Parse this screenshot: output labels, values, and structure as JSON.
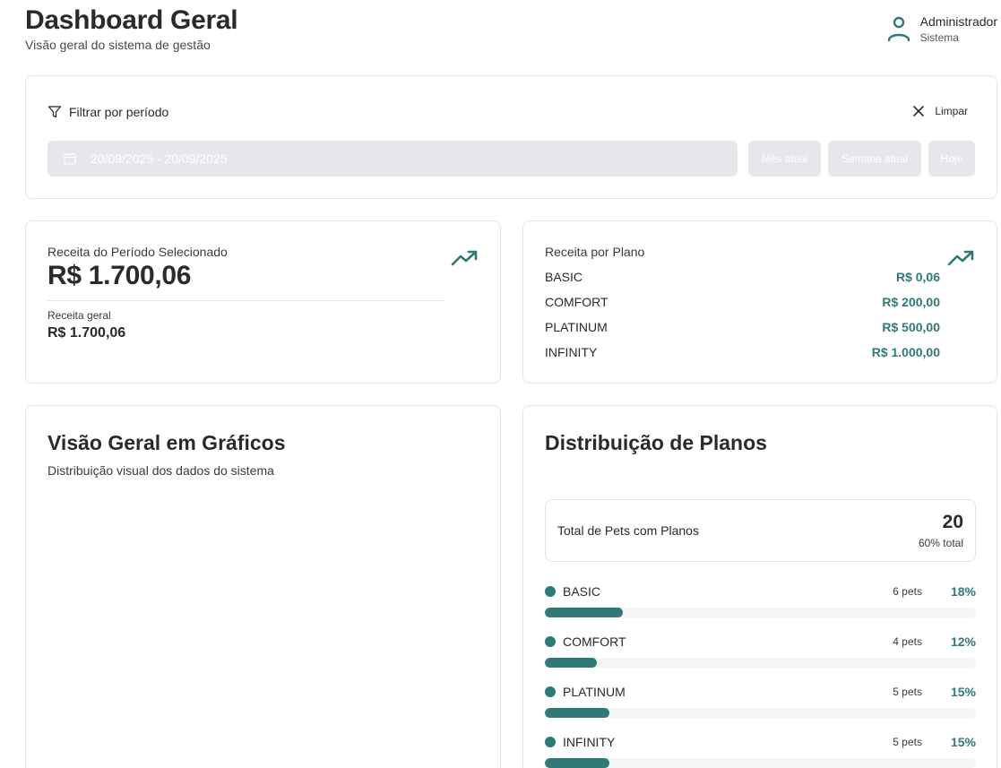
{
  "header": {
    "title": "Dashboard Geral",
    "subtitle": "Visão geral do sistema de gestão",
    "user": {
      "name": "Administrador",
      "role": "Sistema",
      "icon": "user-icon"
    }
  },
  "filter": {
    "title": "Filtrar por período",
    "icon": "filter-icon",
    "clear_label": "Limpar",
    "date_range": "20/09/2025 - 20/09/2025",
    "quick_buttons": {
      "month": "Mês atual",
      "week": "Semana atual",
      "today": "Hoje"
    }
  },
  "revenue": {
    "label": "Receita do Período Selecionado",
    "value": "R$ 1.700,06",
    "sub_label": "Receita geral",
    "sub_value": "R$ 1.700,06",
    "icon": "trending-up-icon"
  },
  "revenue_by_plan": {
    "title": "Receita por Plano",
    "icon": "trending-up-icon",
    "plans": [
      {
        "name": "BASIC",
        "amount": "R$ 0,06"
      },
      {
        "name": "COMFORT",
        "amount": "R$ 200,00"
      },
      {
        "name": "PLATINUM",
        "amount": "R$ 500,00"
      },
      {
        "name": "INFINITY",
        "amount": "R$ 1.000,00"
      }
    ]
  },
  "charts": {
    "title": "Visão Geral em Gráficos",
    "subtitle": "Distribuição visual dos dados do sistema"
  },
  "distribution": {
    "title": "Distribuição de Planos",
    "total_label": "Total de Pets com Planos",
    "total_value": "20",
    "total_pct": "60% total",
    "accent_color": "#2f7a76",
    "items": [
      {
        "name": "BASIC",
        "count": "6 pets",
        "pct": "18%",
        "fraction": 0.18
      },
      {
        "name": "COMFORT",
        "count": "4 pets",
        "pct": "12%",
        "fraction": 0.12
      },
      {
        "name": "PLATINUM",
        "count": "5 pets",
        "pct": "15%",
        "fraction": 0.15
      },
      {
        "name": "INFINITY",
        "count": "5 pets",
        "pct": "15%",
        "fraction": 0.15
      }
    ]
  }
}
